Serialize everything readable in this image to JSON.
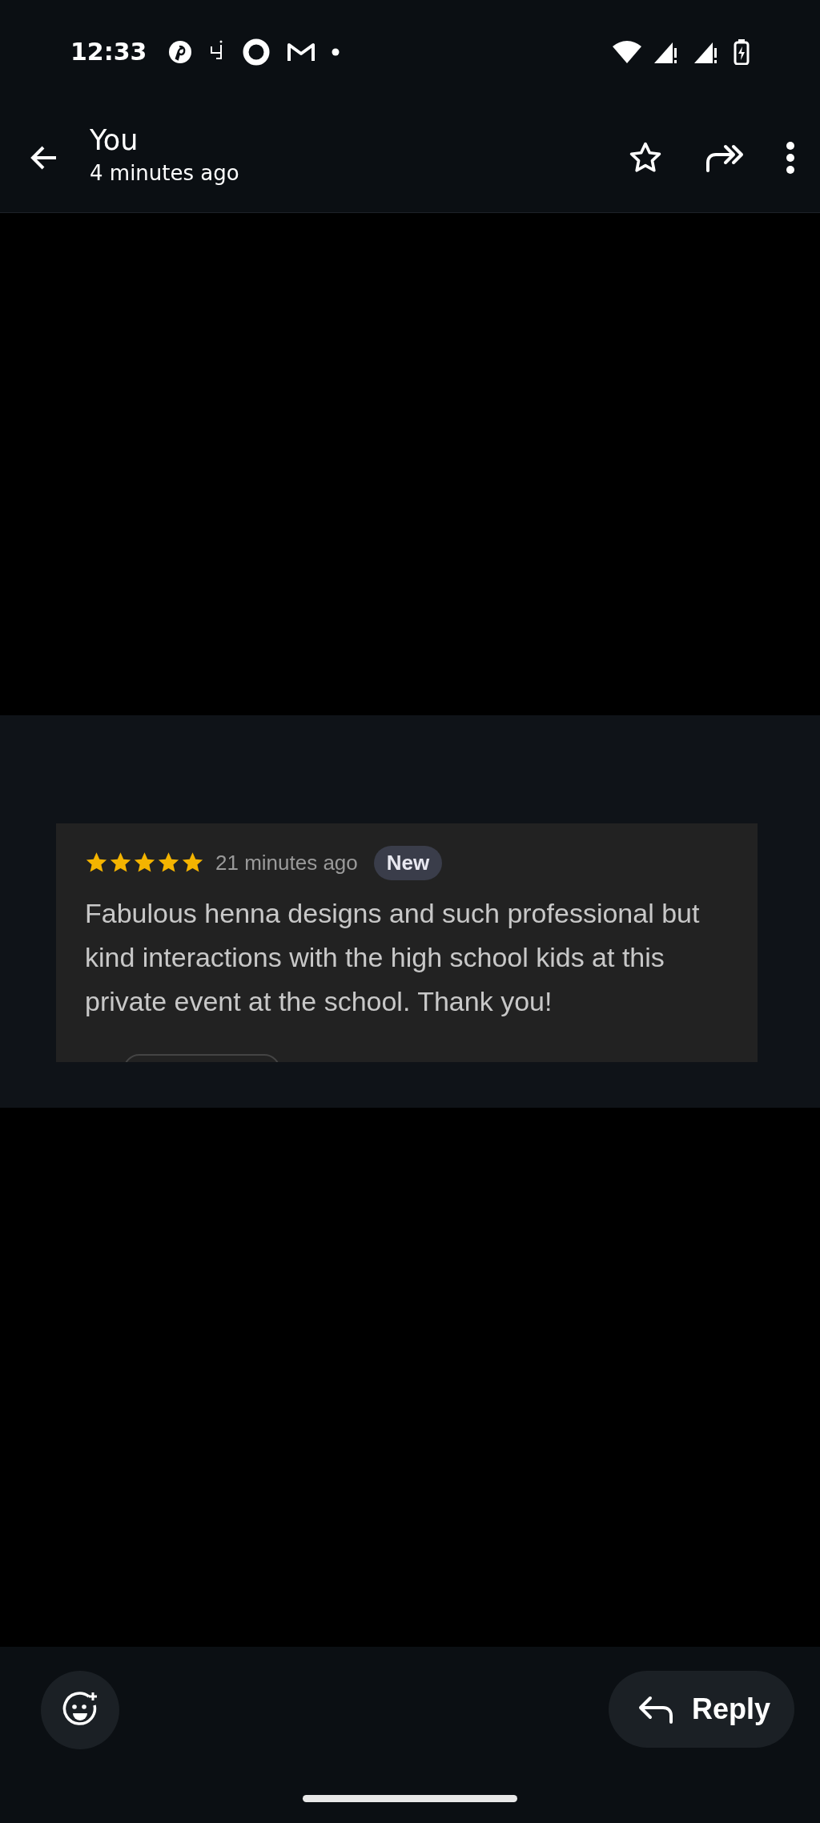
{
  "status_bar": {
    "time": "12:33"
  },
  "header": {
    "title": "You",
    "subtitle": "4 minutes ago",
    "starred": false
  },
  "review": {
    "stars": 5,
    "time": "21 minutes ago",
    "badge": "New",
    "text": "Fabulous henna designs and such professional but kind interactions with the high school kids at this private event at the school. Thank you!"
  },
  "reply_button": {
    "label": "Reply"
  }
}
